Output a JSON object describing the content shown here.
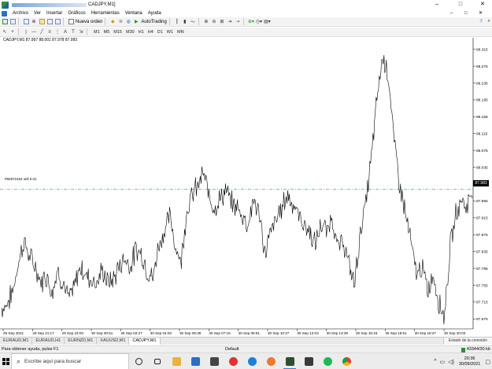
{
  "window": {
    "title": "CADJPY,M1]",
    "controls": [
      "–",
      "□",
      "✕"
    ]
  },
  "menu": {
    "items": [
      "Archivo",
      "Ver",
      "Insertar",
      "Gráficos",
      "Herramientas",
      "Ventana",
      "Ayuda"
    ],
    "right": [
      "–",
      "□",
      "✕"
    ]
  },
  "toolbar": {
    "new_order_label": "Nueva orden",
    "autotrading_label": "AutoTrading",
    "text_tool": "A",
    "label_tool": "T",
    "timeframes": [
      "M1",
      "M5",
      "M15",
      "M30",
      "H1",
      "H4",
      "D1",
      "W1",
      "MN"
    ]
  },
  "chart": {
    "header": "CADJPY,M1  87.997 88.001 87.978 87.983",
    "order_label": "#82872164 sell 0.01",
    "current_price": "87.983",
    "price_labels": [
      "88.315",
      "88.275",
      "88.235",
      "88.195",
      "88.155",
      "88.115",
      "88.075",
      "88.035",
      "87.995",
      "87.955",
      "87.915",
      "87.875",
      "87.835",
      "87.795",
      "87.755",
      "87.715",
      "87.675"
    ],
    "time_labels": [
      "29 Sep 2021",
      "29 Sep 21:17",
      "29 Sep 23:03",
      "30 Sep 00:51",
      "30 Sep 02:27",
      "30 Sep 04:03",
      "30 Sep 05:39",
      "30 Sep 07:15",
      "30 Sep 08:51",
      "30 Sep 10:27",
      "30 Sep 12:03",
      "30 Sep 13:39",
      "30 Sep 15:15",
      "30 Sep 16:51",
      "30 Sep 18:27",
      "30 Sep 20:03"
    ],
    "order_line_color": "#2e9b6e"
  },
  "chart_data": {
    "type": "line",
    "symbol": "CADJPY",
    "timeframe": "M1",
    "x": [
      "29 Sep 2021",
      "29 Sep 21:17",
      "29 Sep 23:03",
      "30 Sep 00:51",
      "30 Sep 02:27",
      "30 Sep 04:03",
      "30 Sep 05:39",
      "30 Sep 07:15",
      "30 Sep 08:51",
      "30 Sep 10:27",
      "30 Sep 12:03",
      "30 Sep 13:39",
      "30 Sep 15:15",
      "30 Sep 16:51",
      "30 Sep 18:27",
      "30 Sep 20:03"
    ],
    "y": [
      87.7,
      87.82,
      87.76,
      87.74,
      87.77,
      87.8,
      87.82,
      87.88,
      87.99,
      87.95,
      87.93,
      87.89,
      87.86,
      88.18,
      87.86,
      87.95
    ],
    "series": [
      {
        "name": "",
        "values": [
          87.7,
          87.71,
          87.74,
          87.81,
          87.86,
          87.82,
          87.8,
          87.76,
          87.78,
          87.74,
          87.79,
          87.76,
          87.72,
          87.75,
          87.8,
          87.78,
          87.77,
          87.76,
          87.79,
          87.76,
          87.77,
          87.8,
          87.82,
          87.8,
          87.84,
          87.83,
          87.79,
          87.77,
          87.85,
          87.88,
          87.92,
          87.85,
          87.81,
          87.93,
          87.97,
          87.99,
          88.02,
          87.97,
          87.94,
          87.96,
          87.98,
          87.95,
          87.94,
          87.92,
          87.9,
          87.96,
          87.92,
          87.83,
          87.88,
          87.91,
          87.94,
          87.97,
          87.95,
          87.92,
          87.9,
          87.88,
          87.85,
          87.9,
          87.88,
          87.92,
          87.84,
          87.86,
          87.8,
          87.76,
          87.88,
          87.95,
          88.06,
          88.2,
          88.3,
          88.26,
          88.1,
          88.0,
          87.93,
          87.86,
          87.78,
          87.8,
          87.74,
          87.78,
          87.72,
          87.68,
          87.84,
          87.92,
          87.96,
          87.94,
          87.98
        ]
      }
    ],
    "ylim": [
      87.655,
      88.335
    ],
    "xlabel": "",
    "ylabel": "",
    "grid": false
  },
  "tabs": {
    "items": [
      "EURAUD,M1",
      "EURAUD,H1",
      "EURNZD,M1",
      "XAUUSD,M1",
      "CADJPY,M1"
    ],
    "active_index": 4,
    "connection_status": "Estado de la conexión"
  },
  "statusbar": {
    "help": "Para obtener ayuda, pulse F1",
    "profile": "Default",
    "traffic": "43344/30 kb"
  },
  "taskbar": {
    "search_placeholder": "Escribe aquí para buscar",
    "time": "20:36",
    "date": "30/09/2021",
    "apps": [
      "task-view-icon",
      "file-explorer-icon",
      "mail-icon",
      "store-icon",
      "opera-icon",
      "edge-icon",
      "firefox-icon",
      "metatrader-icon",
      "terminal-icon",
      "spotify-icon",
      "chrome-icon"
    ]
  }
}
